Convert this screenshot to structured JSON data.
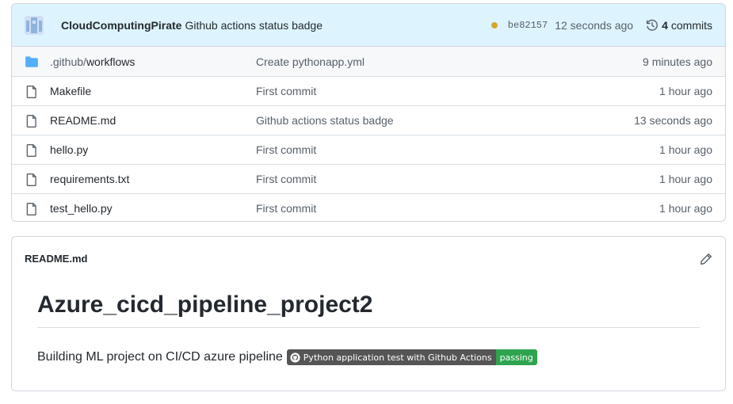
{
  "commit": {
    "author": "CloudComputingPirate",
    "message": "Github actions status badge",
    "sha": "be82157",
    "time": "12 seconds ago",
    "commit_count": "4",
    "commit_label": "commits",
    "status_color": "#d4a72c"
  },
  "files": [
    {
      "name_prefix": ".github/",
      "name": "workflows",
      "type": "folder-icon",
      "commit": "Create pythonapp.yml",
      "age": "9 minutes ago"
    },
    {
      "name_prefix": "",
      "name": "Makefile",
      "type": "file-icon",
      "commit": "First commit",
      "age": "1 hour ago"
    },
    {
      "name_prefix": "",
      "name": "README.md",
      "type": "file-icon",
      "commit": "Github actions status badge",
      "age": "13 seconds ago"
    },
    {
      "name_prefix": "",
      "name": "hello.py",
      "type": "file-icon",
      "commit": "First commit",
      "age": "1 hour ago"
    },
    {
      "name_prefix": "",
      "name": "requirements.txt",
      "type": "file-icon",
      "commit": "First commit",
      "age": "1 hour ago"
    },
    {
      "name_prefix": "",
      "name": "test_hello.py",
      "type": "file-icon",
      "commit": "First commit",
      "age": "1 hour ago"
    }
  ],
  "readme": {
    "filename": "README.md",
    "heading": "Azure_cicd_pipeline_project2",
    "paragraph": "Building ML project on CI/CD azure pipeline",
    "badge_label": "Python application test with Github Actions",
    "badge_status": "passing",
    "badge_status_color": "#2ea44f"
  },
  "icons": {
    "edit": "pencil-icon",
    "history": "history-icon",
    "avatar": "avatar-icon",
    "github": "github-icon"
  }
}
